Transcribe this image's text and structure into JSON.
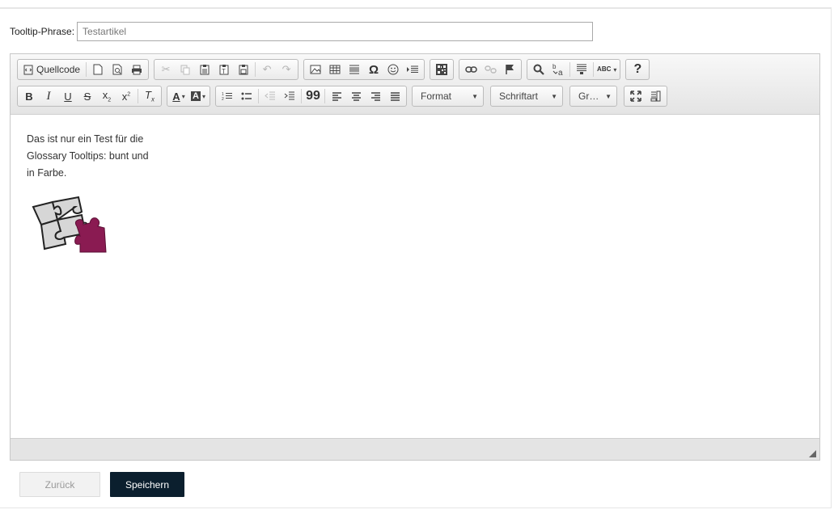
{
  "field": {
    "label": "Tooltip-Phrase:",
    "value": "Testartikel"
  },
  "toolbar": {
    "source_label": "Quellcode",
    "format_label": "Format",
    "font_label": "Schriftart",
    "size_label": "Gr…"
  },
  "content": {
    "lines": [
      "Das ist nur ein Test für die",
      "Glossary Tooltips: bunt und",
      "in Farbe."
    ]
  },
  "buttons": {
    "back": "Zurück",
    "save": "Speichern"
  },
  "colors": {
    "accent": "#0b1f2e",
    "puzzle": "#8a1b52"
  },
  "icons": {
    "quote": "99",
    "special_char": "Ω",
    "help": "?",
    "spell": "ABC"
  }
}
